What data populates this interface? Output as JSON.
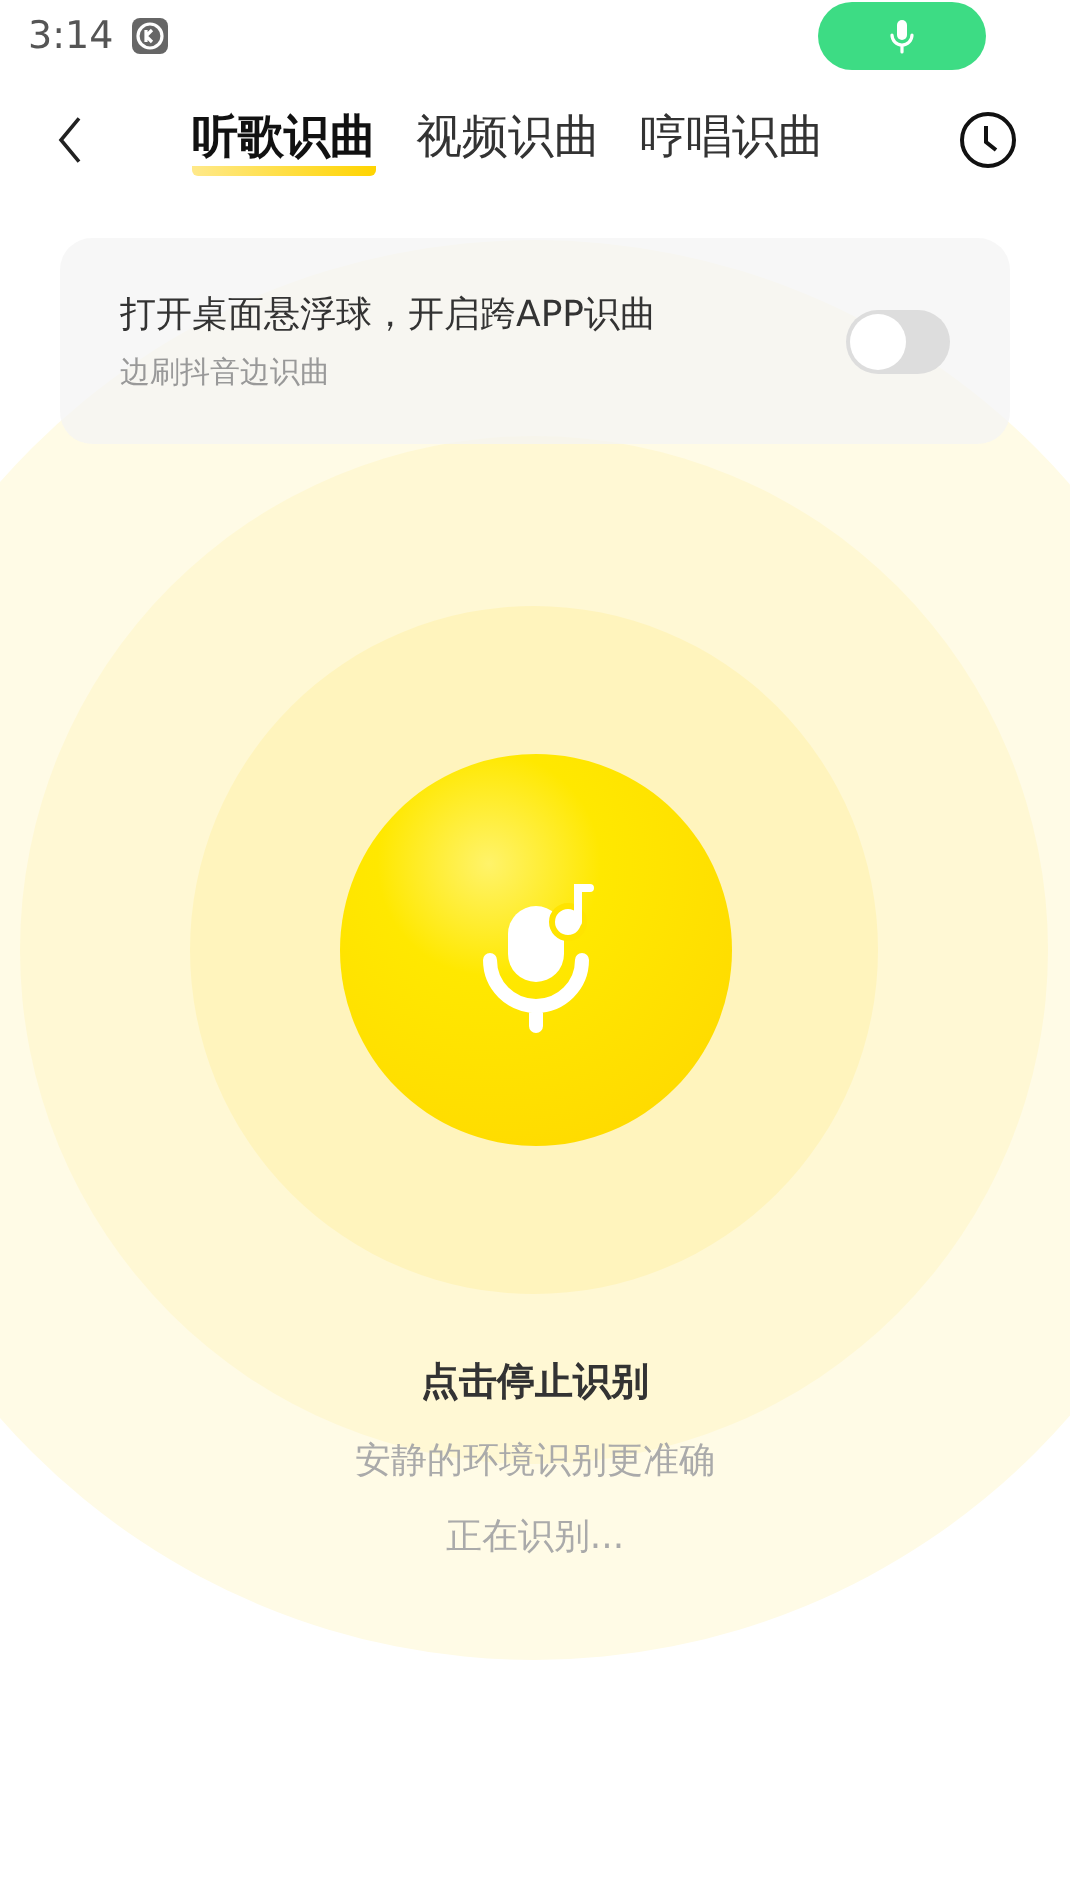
{
  "status_bar": {
    "time": "3:14"
  },
  "tabs": [
    {
      "label": "听歌识曲",
      "selected": true
    },
    {
      "label": "视频识曲",
      "selected": false
    },
    {
      "label": "哼唱识曲",
      "selected": false
    }
  ],
  "float_card": {
    "title": "打开桌面悬浮球，开启跨APP识曲",
    "subtitle": "边刷抖音边识曲",
    "on": false
  },
  "recognize": {
    "action": "点击停止识别",
    "tip": "安静的环境识别更准确",
    "status": "正在识别..."
  }
}
